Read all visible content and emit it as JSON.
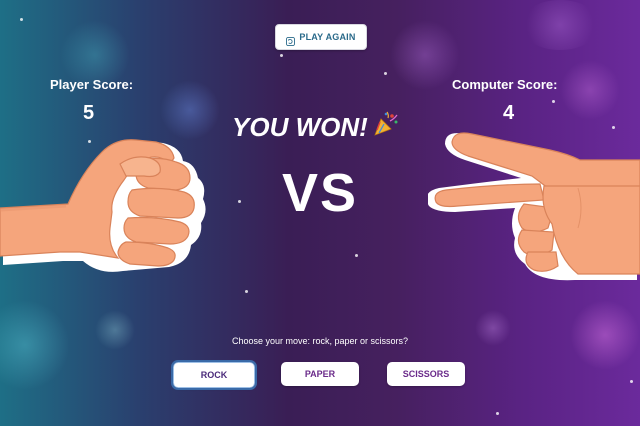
{
  "header": {
    "play_again_label": "PLAY AGAIN",
    "play_again_icon": "replay-icon"
  },
  "player": {
    "label": "Player Score:",
    "score": "5",
    "hand": "rock"
  },
  "computer": {
    "label": "Computer Score:",
    "score": "4",
    "hand": "scissors"
  },
  "result": {
    "text": "YOU WON!",
    "icon": "party-popper-icon"
  },
  "vs_text": "VS",
  "moves": {
    "prompt": "Choose your move: rock, paper or scissors?",
    "rock_label": "ROCK",
    "paper_label": "PAPER",
    "scissors_label": "SCISSORS",
    "selected": "rock"
  },
  "colors": {
    "accent_text": "#6a2a8a",
    "skin": "#f5a57c",
    "background_left": "#1e6f86",
    "background_right": "#6b2a9c"
  }
}
